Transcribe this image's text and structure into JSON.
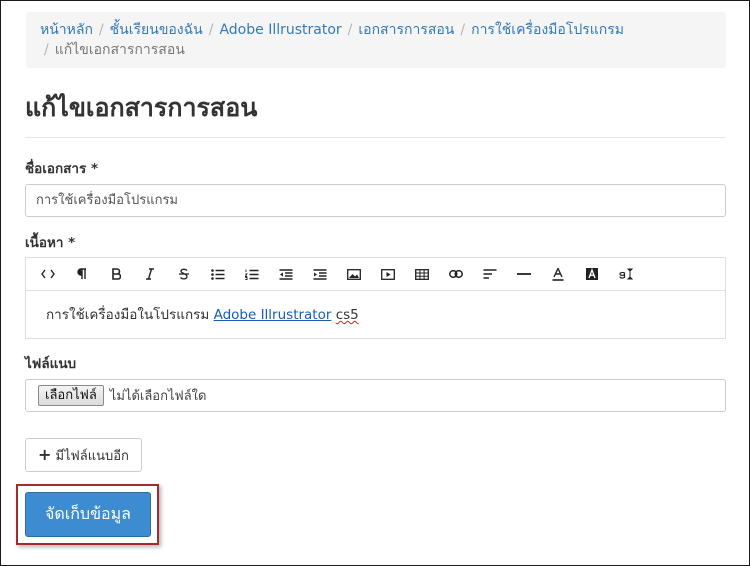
{
  "breadcrumb": {
    "items": [
      "หน้าหลัก",
      "ชั้นเรียนของฉัน",
      "Adobe Illrustrator",
      "เอกสารการสอน",
      "การใช้เครื่องมือโปรแกรม"
    ],
    "active": "แก้ไขเอกสารการสอน",
    "separator": "/"
  },
  "page_title": "แก้ไขเอกสารการสอน",
  "form": {
    "name_label": "ชื่อเอกสาร *",
    "name_value": "การใช้เครื่องมือโปรแกรม",
    "content_label": "เนื้อหา *",
    "content_prefix": "การใช้เครื่องมือในโปรแกรม",
    "content_link": "Adobe Illrustrator",
    "content_suffix": "cs5",
    "attachment_label": "ไฟล์แนบ",
    "file_button": "เลือกไฟล์",
    "file_status": "ไม่ได้เลือกไฟล์ใด",
    "more_files_button": "มีไฟล์แนบอีก",
    "save_button": "จัดเก็บข้อมูล"
  },
  "toolbar_icons": [
    "code-view-icon",
    "paragraph-icon",
    "bold-icon",
    "italic-icon",
    "strikethrough-icon",
    "unordered-list-icon",
    "ordered-list-icon",
    "outdent-icon",
    "indent-icon",
    "image-icon",
    "video-icon",
    "table-icon",
    "link-icon",
    "align-icon",
    "horizontal-rule-icon",
    "font-color-icon",
    "background-color-icon",
    "font-size-icon"
  ],
  "colors": {
    "link": "#337ab7",
    "primary_button": "#3d8bd0",
    "highlight_border": "#a32b2b"
  }
}
